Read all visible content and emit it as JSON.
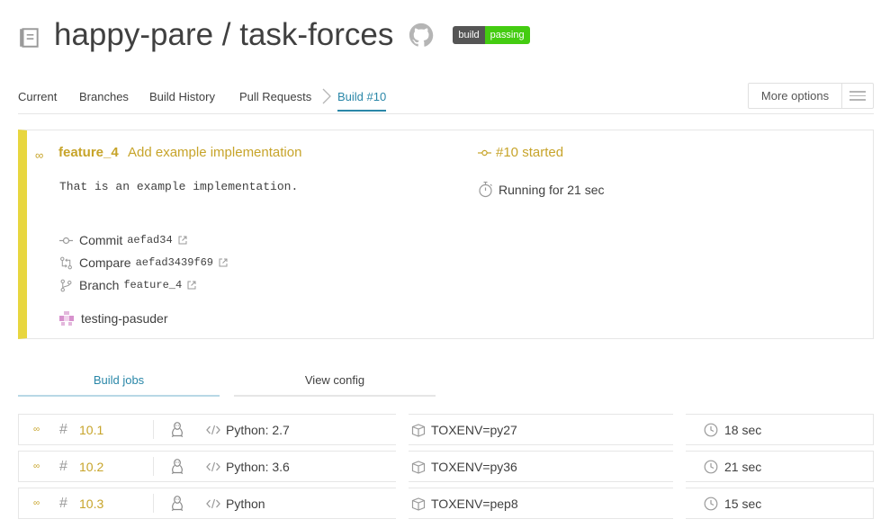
{
  "header": {
    "repo_title": "happy-pare / task-forces",
    "badge_left": "build",
    "badge_right": "passing"
  },
  "tabs": {
    "current": "Current",
    "branches": "Branches",
    "history": "Build History",
    "pull_requests": "Pull Requests",
    "build": "Build #10",
    "more_options": "More options"
  },
  "build": {
    "branch": "feature_4",
    "commit_title": "Add example implementation",
    "commit_message": "That is an example implementation.",
    "commit_label": "Commit",
    "commit_hash": "aefad34",
    "compare_label": "Compare",
    "compare_hash": "aefad3439f69",
    "branch_label": "Branch",
    "branch_value": "feature_4",
    "author": "testing-pasuder",
    "status": "#10 started",
    "duration": "Running for 21 sec",
    "accent_color": "#e8d63f"
  },
  "subtabs": {
    "jobs": "Build jobs",
    "config": "View config"
  },
  "jobs": [
    {
      "number": "10.1",
      "language": "Python: 2.7",
      "env": "TOXENV=py27",
      "time": "18 sec"
    },
    {
      "number": "10.2",
      "language": "Python: 3.6",
      "env": "TOXENV=py36",
      "time": "21 sec"
    },
    {
      "number": "10.3",
      "language": "Python",
      "env": "TOXENV=pep8",
      "time": "15 sec"
    }
  ]
}
